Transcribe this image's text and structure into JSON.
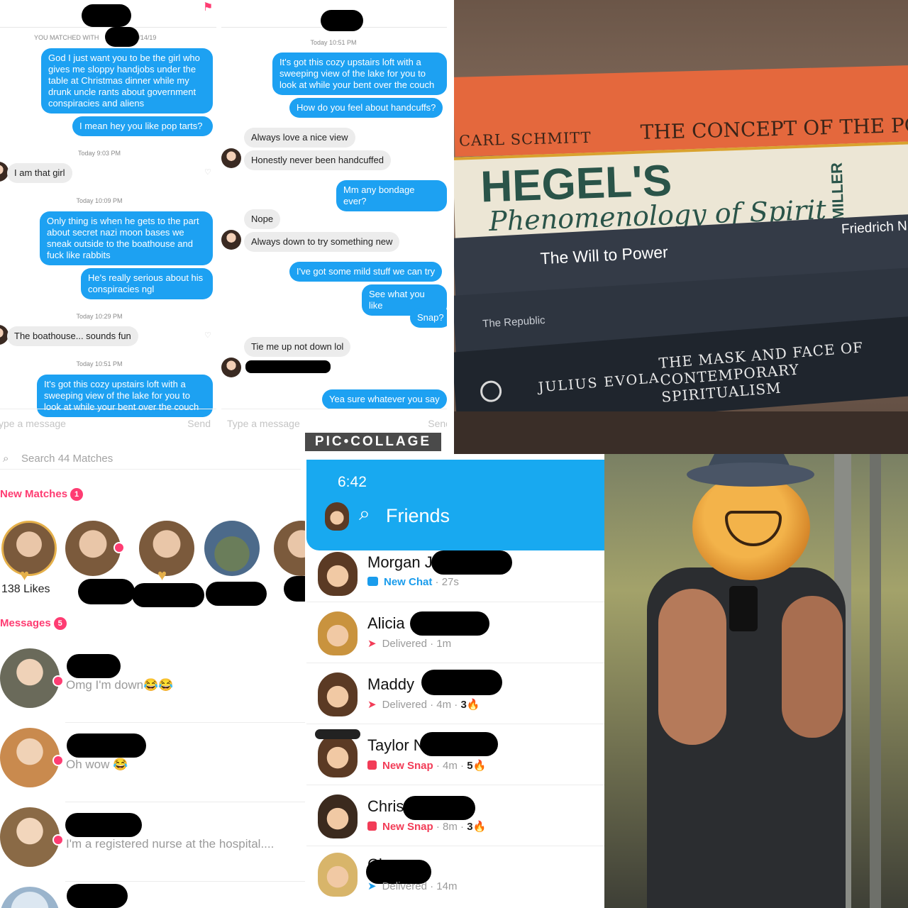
{
  "chat_left": {
    "matched_prefix": "YOU MATCHED WITH",
    "matched_date": "0/14/19",
    "messages": [
      {
        "text": "God I just want you to be the girl who gives me sloppy handjobs under the table at Christmas dinner while my drunk uncle rants about government conspiracies and aliens"
      },
      {
        "text": "I mean hey you like pop tarts?"
      },
      {
        "text": "I am that girl"
      },
      {
        "text": "Only thing is when he gets to the part about secret nazi moon bases we sneak outside to the boathouse and fuck like rabbits"
      },
      {
        "text": "He's really serious about his conspiracies ngl"
      },
      {
        "text": "The boathouse... sounds fun"
      },
      {
        "text": "It's got this cozy upstairs loft with a sweeping view of the lake for you to look at while your bent over the couch"
      }
    ],
    "stamps": [
      "Today 9:03 PM",
      "Today 10:09 PM",
      "Today 10:29 PM",
      "Today 10:51 PM"
    ],
    "input_placeholder": "ype a message",
    "send_label": "Send"
  },
  "chat_right": {
    "stamp": "Today 10:51 PM",
    "messages": [
      {
        "text": "It's got this cozy upstairs loft with a sweeping view of the lake for you to look at while your bent over the couch"
      },
      {
        "text": "How do you feel about handcuffs?"
      },
      {
        "text": "Always love a nice view"
      },
      {
        "text": "Honestly never been handcuffed"
      },
      {
        "text": "Mm any bondage ever?"
      },
      {
        "text": "Nope"
      },
      {
        "text": "Always down to try something new"
      },
      {
        "text": "I've got some mild stuff we can try"
      },
      {
        "text": "See what you like"
      },
      {
        "text": "Snap?"
      },
      {
        "text": "Tie me up not down lol"
      },
      {
        "text": "Yea sure whatever you say"
      }
    ],
    "input_placeholder": "Type a message",
    "send_label": "Send"
  },
  "watermark": "PIC•COLLAGE",
  "books": [
    {
      "author": "CARL SCHMITT",
      "title": "THE CONCEPT OF THE POLITIC"
    },
    {
      "title": "HEGEL'S",
      "subtitle": "Phenomenology of Spirit",
      "spine": "MILLER"
    },
    {
      "title": "The Will to Power",
      "author": "Friedrich N"
    },
    {
      "title": "The Republic"
    },
    {
      "author": "JULIUS EVOLA",
      "title": "THE MASK AND FACE OF CONTEMPORARY SPIRITUALISM"
    }
  ],
  "tinder": {
    "search_placeholder": "Search 44 Matches",
    "new_matches_label": "New Matches",
    "new_matches_count": "1",
    "likes_label": "138 Likes",
    "messages_label": "Messages",
    "messages_count": "5",
    "threads": [
      {
        "preview": "Omg I'm down😂😂"
      },
      {
        "preview": "Oh wow 😂"
      },
      {
        "preview": "I'm a registered nurse at the hospital...."
      }
    ]
  },
  "snapchat": {
    "time": "6:42",
    "title": "Friends",
    "friends": [
      {
        "name": "Morgan J",
        "status": "New Chat",
        "age": "27s",
        "streak": "",
        "kind": "chat"
      },
      {
        "name": "Alicia",
        "status": "Delivered",
        "age": "1m",
        "streak": "",
        "kind": "delivered"
      },
      {
        "name": "Maddy",
        "status": "Delivered",
        "age": "4m",
        "streak": "3🔥",
        "kind": "delivered"
      },
      {
        "name": "Taylor N",
        "status": "New Snap",
        "age": "4m",
        "streak": "5🔥",
        "kind": "snap"
      },
      {
        "name": "Chris",
        "status": "New Snap",
        "age": "8m",
        "streak": "3🔥",
        "kind": "snap"
      },
      {
        "name": "Ch",
        "status": "Delivered",
        "age": "14m",
        "streak": "",
        "kind": "delivered"
      }
    ]
  },
  "colors": {
    "imessage_blue": "#1da1f2",
    "tinder_pink": "#fe3c72",
    "snap_blue": "#18a9f0",
    "snap_red": "#f23c57"
  }
}
